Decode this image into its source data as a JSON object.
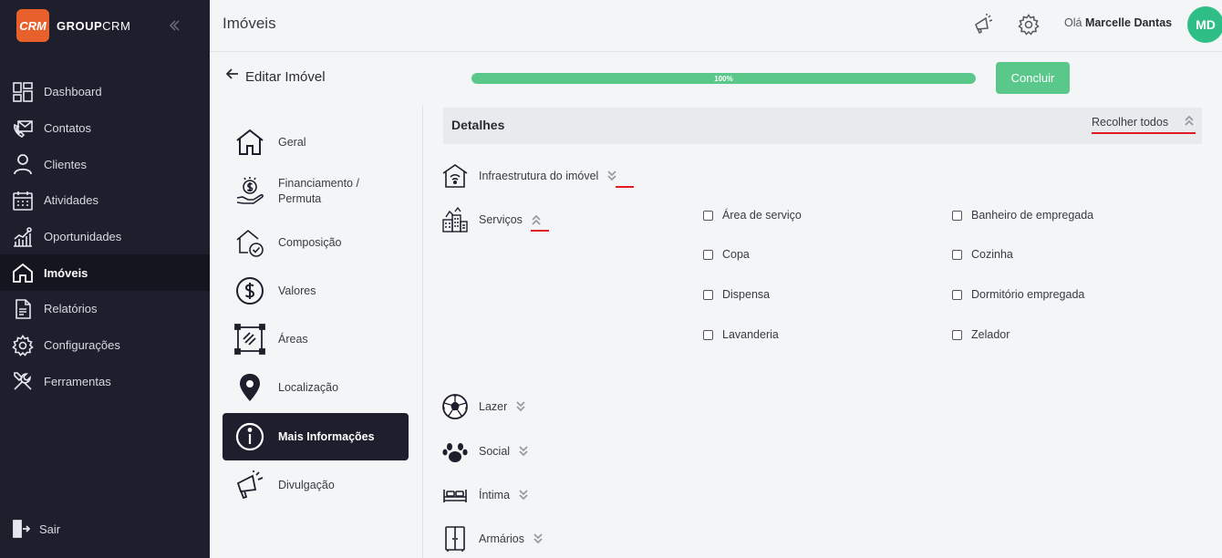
{
  "brand": {
    "logo_text": "CRM",
    "name_bold": "GROUP",
    "name_light": "CRM"
  },
  "sidebar": {
    "items": [
      {
        "label": "Dashboard",
        "icon": "dashboard-icon"
      },
      {
        "label": "Contatos",
        "icon": "contacts-icon"
      },
      {
        "label": "Clientes",
        "icon": "user-icon"
      },
      {
        "label": "Atividades",
        "icon": "calendar-icon"
      },
      {
        "label": "Oportunidades",
        "icon": "chart-growth-icon"
      },
      {
        "label": "Imóveis",
        "icon": "home-icon"
      },
      {
        "label": "Relatórios",
        "icon": "document-icon"
      },
      {
        "label": "Configurações",
        "icon": "gear-icon"
      },
      {
        "label": "Ferramentas",
        "icon": "tools-icon"
      }
    ],
    "active": "Imóveis",
    "logout": "Sair"
  },
  "header": {
    "title": "Imóveis",
    "greeting_prefix": "Olá",
    "user_name": "Marcelle Dantas",
    "avatar_initials": "MD"
  },
  "editor": {
    "title": "Editar Imóvel",
    "progress_percent": 100,
    "progress_label": "100%",
    "complete_button": "Concluir"
  },
  "sections": [
    {
      "label": "Geral",
      "icon": "home-icon"
    },
    {
      "label": "Financiamento / Permuta",
      "icon": "money-hand-icon"
    },
    {
      "label": "Composição",
      "icon": "house-check-icon"
    },
    {
      "label": "Valores",
      "icon": "dollar-circle-icon"
    },
    {
      "label": "Áreas",
      "icon": "area-icon"
    },
    {
      "label": "Localização",
      "icon": "map-pin-icon"
    },
    {
      "label": "Mais Informações",
      "icon": "info-icon"
    },
    {
      "label": "Divulgação",
      "icon": "megaphone-icon"
    }
  ],
  "active_section": "Mais Informações",
  "details": {
    "title": "Detalhes",
    "collapse_all": "Recolher todos",
    "groups": [
      {
        "label": "Infraestrutura do imóvel",
        "expanded": false
      },
      {
        "label": "Serviços",
        "expanded": true
      },
      {
        "label": "Lazer",
        "expanded": false
      },
      {
        "label": "Social",
        "expanded": false
      },
      {
        "label": "Íntima",
        "expanded": false
      },
      {
        "label": "Armários",
        "expanded": false
      }
    ],
    "services_options": [
      {
        "label": "Área de serviço",
        "checked": false
      },
      {
        "label": "Banheiro de empregada",
        "checked": false
      },
      {
        "label": "Copa",
        "checked": false
      },
      {
        "label": "Cozinha",
        "checked": false
      },
      {
        "label": "Dispensa",
        "checked": false
      },
      {
        "label": "Dormitório empregada",
        "checked": false
      },
      {
        "label": "Lavanderia",
        "checked": false
      },
      {
        "label": "Zelador",
        "checked": false
      }
    ]
  },
  "colors": {
    "sidebar": "#1e1e2d",
    "accent_green": "#5ac88a",
    "brand_orange": "#e8612c",
    "avatar": "#2fbf86",
    "highlight_red": "#e01b24"
  }
}
